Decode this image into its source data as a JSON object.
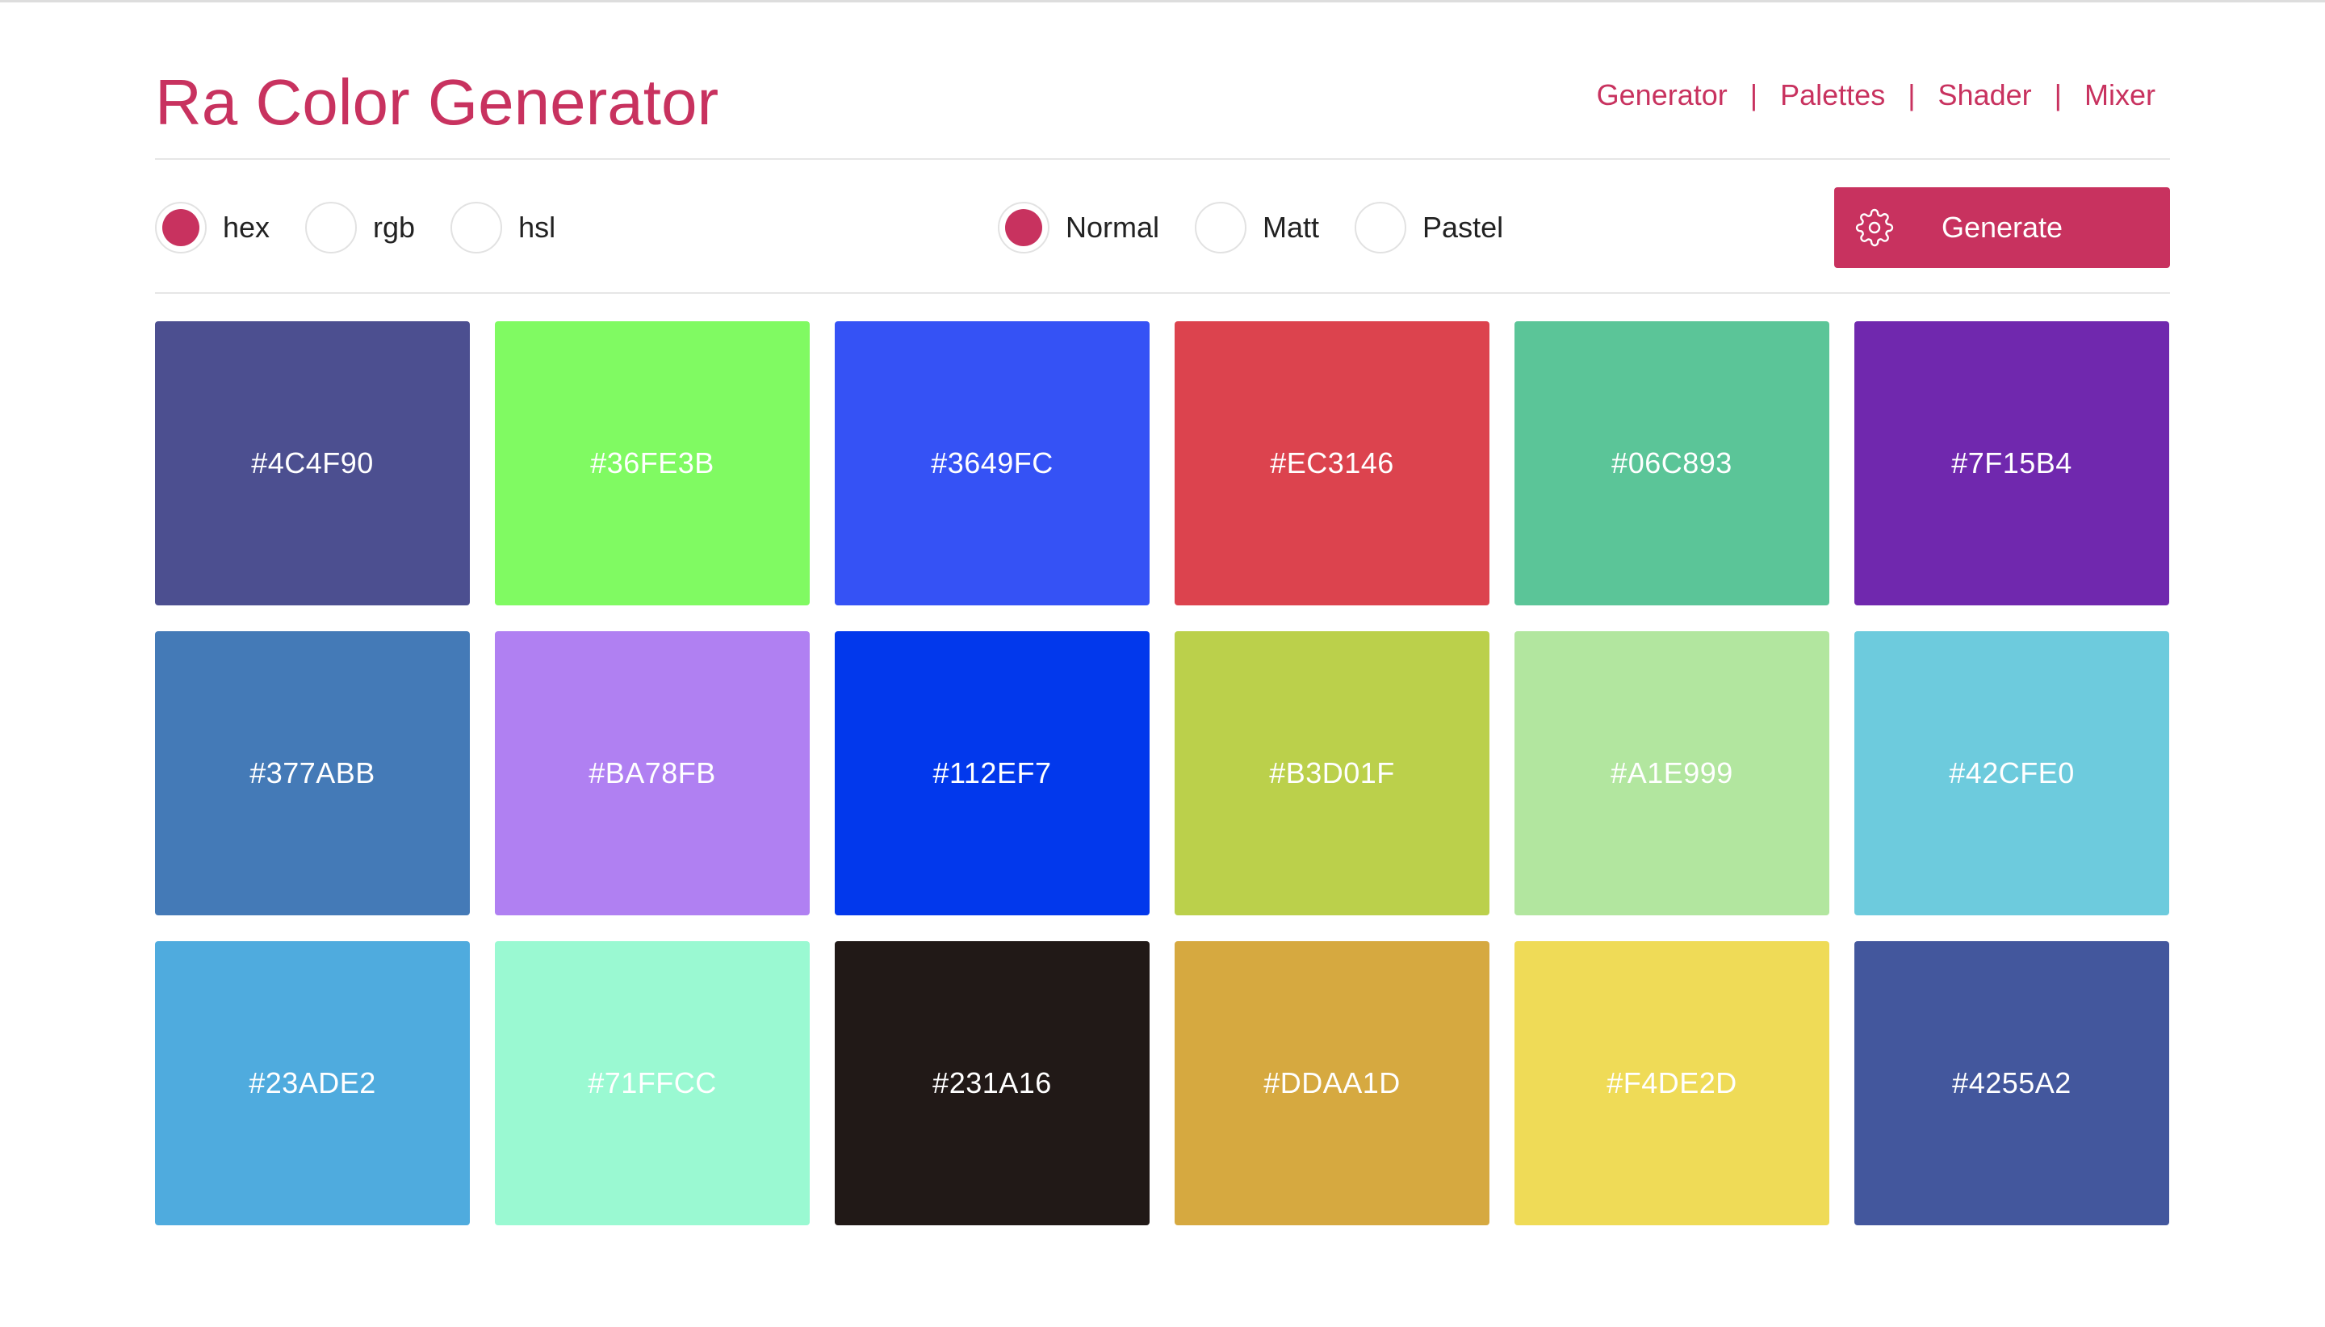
{
  "header": {
    "title": "Ra Color Generator",
    "nav": [
      {
        "label": "Generator"
      },
      {
        "label": "Palettes"
      },
      {
        "label": "Shader"
      },
      {
        "label": "Mixer"
      }
    ],
    "separator": "|"
  },
  "format_options": [
    {
      "label": "hex",
      "checked": true
    },
    {
      "label": "rgb",
      "checked": false
    },
    {
      "label": "hsl",
      "checked": false
    }
  ],
  "style_options": [
    {
      "label": "Normal",
      "checked": true
    },
    {
      "label": "Matt",
      "checked": false
    },
    {
      "label": "Pastel",
      "checked": false
    }
  ],
  "generate_button": {
    "label": "Generate",
    "icon": "gear-icon"
  },
  "colors": {
    "accent": "#C8325F"
  },
  "swatches": [
    {
      "label": "#4C4F90",
      "color": "#4C4F90"
    },
    {
      "label": "#36FE3B",
      "color": "#80FA62"
    },
    {
      "label": "#3649FC",
      "color": "#3552F5"
    },
    {
      "label": "#EC3146",
      "color": "#DC434E"
    },
    {
      "label": "#06C893",
      "color": "#5BC598"
    },
    {
      "label": "#7F15B4",
      "color": "#7028AE"
    },
    {
      "label": "#377ABB",
      "color": "#447AB7"
    },
    {
      "label": "#BA78FB",
      "color": "#B080F2"
    },
    {
      "label": "#112EF7",
      "color": "#0238EC"
    },
    {
      "label": "#B3D01F",
      "color": "#BBD04B"
    },
    {
      "label": "#A1E999",
      "color": "#B2E69F"
    },
    {
      "label": "#42CFE0",
      "color": "#6DCBDD"
    },
    {
      "label": "#23ADE2",
      "color": "#4FABDE"
    },
    {
      "label": "#71FFCC",
      "color": "#9AF9D2"
    },
    {
      "label": "#231A16",
      "color": "#211917"
    },
    {
      "label": "#DDAA1D",
      "color": "#D6A940"
    },
    {
      "label": "#F4DE2D",
      "color": "#EFDB57"
    },
    {
      "label": "#4255A2",
      "color": "#43579D"
    }
  ]
}
